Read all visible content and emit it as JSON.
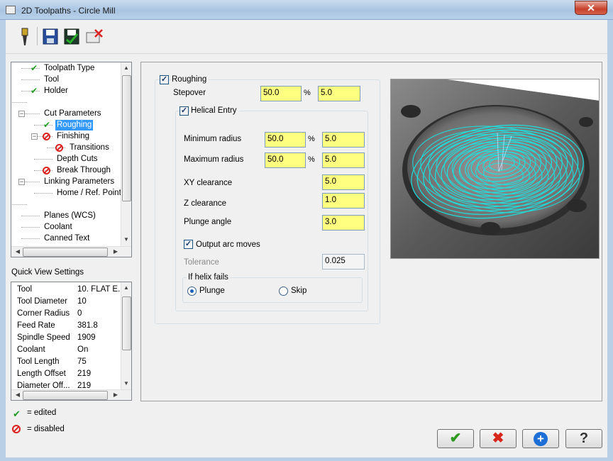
{
  "window": {
    "title": "2D Toolpaths - Circle Mill",
    "close": "✕"
  },
  "toolbar": {
    "icons": [
      "tool-icon",
      "save-icon",
      "save-green-icon",
      "cancel-red-icon"
    ]
  },
  "tree": {
    "items": [
      {
        "label": "Toolpath Type",
        "mark": "check"
      },
      {
        "label": "Tool",
        "mark": ""
      },
      {
        "label": "Holder",
        "mark": "check"
      },
      {
        "label": "",
        "mark": ""
      },
      {
        "label": "Cut Parameters",
        "mark": ""
      },
      {
        "label": "Roughing",
        "mark": "check",
        "selected": true
      },
      {
        "label": "Finishing",
        "mark": "disabled"
      },
      {
        "label": "Transitions",
        "mark": "disabled"
      },
      {
        "label": "Depth Cuts",
        "mark": ""
      },
      {
        "label": "Break Through",
        "mark": "disabled"
      },
      {
        "label": "Linking Parameters",
        "mark": ""
      },
      {
        "label": "Home / Ref. Points",
        "mark": ""
      },
      {
        "label": "",
        "mark": ""
      },
      {
        "label": "Planes (WCS)",
        "mark": ""
      },
      {
        "label": "Coolant",
        "mark": ""
      },
      {
        "label": "Canned Text",
        "mark": ""
      }
    ]
  },
  "quick_view": {
    "title": "Quick View Settings",
    "rows": [
      {
        "k": "Tool",
        "v": "10. FLAT E..."
      },
      {
        "k": "Tool Diameter",
        "v": "10"
      },
      {
        "k": "Corner Radius",
        "v": "0"
      },
      {
        "k": "Feed Rate",
        "v": "381.8"
      },
      {
        "k": "Spindle Speed",
        "v": "1909"
      },
      {
        "k": "Coolant",
        "v": "On"
      },
      {
        "k": "Tool Length",
        "v": "75"
      },
      {
        "k": "Length Offset",
        "v": "219"
      },
      {
        "k": "Diameter Off...",
        "v": "219"
      }
    ]
  },
  "legend": {
    "edited": "= edited",
    "disabled": "= disabled"
  },
  "roughing": {
    "label": "Roughing",
    "checked": true,
    "stepover_label": "Stepover",
    "stepover_pct": "50.0",
    "stepover_val": "5.0",
    "pct": "%",
    "helical": {
      "label": "Helical Entry",
      "checked": true,
      "min_radius_label": "Minimum radius",
      "min_radius_pct": "50.0",
      "min_radius_val": "5.0",
      "max_radius_label": "Maximum radius",
      "max_radius_pct": "50.0",
      "max_radius_val": "5.0",
      "xy_clearance_label": "XY clearance",
      "xy_clearance": "5.0",
      "z_clearance_label": "Z clearance",
      "z_clearance": "1.0",
      "plunge_angle_label": "Plunge angle",
      "plunge_angle": "3.0",
      "output_arc_label": "Output arc moves",
      "output_arc_checked": true,
      "tolerance_label": "Tolerance",
      "tolerance": "0.025",
      "fail_group": "If helix fails",
      "plunge": "Plunge",
      "skip": "Skip",
      "selected": "Plunge"
    }
  },
  "buttons": {
    "ok": "✔",
    "cancel": "✖",
    "add": "+",
    "help": "?"
  },
  "colors": {
    "input_yellow": "#ffff80",
    "toolpath_cyan": "#19e3e0",
    "ok_green": "#2e9a20",
    "cancel_red": "#d8261c",
    "add_blue": "#1d6fd6"
  }
}
